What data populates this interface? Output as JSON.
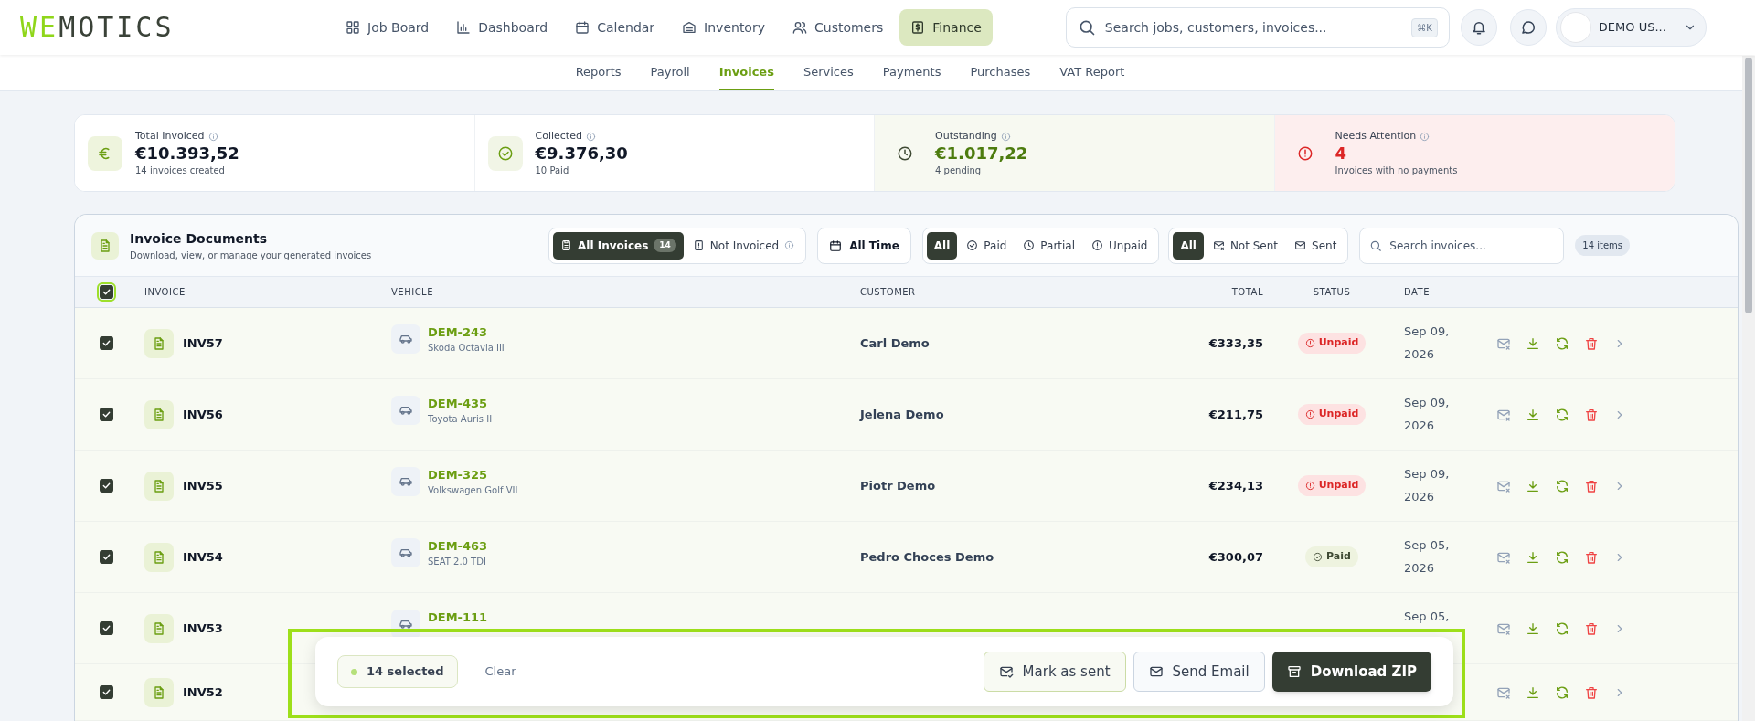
{
  "logo": {
    "part_1": "WE",
    "part_2": "MOTICS"
  },
  "nav": [
    {
      "label": "Job Board",
      "selected": false
    },
    {
      "label": "Dashboard",
      "selected": false
    },
    {
      "label": "Calendar",
      "selected": false
    },
    {
      "label": "Inventory",
      "selected": false
    },
    {
      "label": "Customers",
      "selected": false
    },
    {
      "label": "Finance",
      "selected": true
    }
  ],
  "search": {
    "placeholder": "Search jobs, customers, invoices...",
    "shortcut": "⌘K"
  },
  "user": {
    "name": "DEMO US..."
  },
  "subnav": [
    {
      "label": "Reports",
      "selected": false
    },
    {
      "label": "Payroll",
      "selected": false
    },
    {
      "label": "Invoices",
      "selected": true
    },
    {
      "label": "Services",
      "selected": false
    },
    {
      "label": "Payments",
      "selected": false
    },
    {
      "label": "Purchases",
      "selected": false
    },
    {
      "label": "VAT Report",
      "selected": false
    }
  ],
  "stats": [
    {
      "kind": "total",
      "label": "Total Invoiced",
      "value": "€10.393,52",
      "note": "14 invoices created"
    },
    {
      "kind": "collected",
      "label": "Collected",
      "value": "€9.376,30",
      "note": "10 Paid"
    },
    {
      "kind": "outstanding",
      "label": "Outstanding",
      "value": "€1.017,22",
      "note": "4 pending"
    },
    {
      "kind": "attention",
      "label": "Needs Attention",
      "value": "4",
      "note": "Invoices with no payments"
    }
  ],
  "panel": {
    "title": "Invoice Documents",
    "subtitle": "Download, view, or manage your generated invoices",
    "invoice_filters": [
      {
        "label": "All Invoices",
        "count": "14",
        "selected": true
      },
      {
        "label": "Not Invoiced",
        "selected": false
      }
    ],
    "period": "All Time",
    "payment_filters": [
      {
        "label": "All",
        "selected": true
      },
      {
        "label": "Paid",
        "selected": false
      },
      {
        "label": "Partial",
        "selected": false
      },
      {
        "label": "Unpaid",
        "selected": false
      }
    ],
    "sent_filters": [
      {
        "label": "All",
        "selected": true
      },
      {
        "label": "Not Sent",
        "selected": false
      },
      {
        "label": "Sent",
        "selected": false
      }
    ],
    "search_placeholder": "Search invoices...",
    "item_count": "14 items"
  },
  "table": {
    "all_selected": true,
    "columns": [
      "INVOICE",
      "VEHICLE",
      "CUSTOMER",
      "TOTAL",
      "STATUS",
      "DATE"
    ],
    "rows": [
      {
        "checked": true,
        "invoice": "INV57",
        "plate": "DEM-243",
        "model": "Skoda Octavia III",
        "customer": "Carl Demo",
        "total": "€333,35",
        "status": {
          "kind": "unpaid",
          "label": "Unpaid"
        },
        "date": "Sep 09, 2026"
      },
      {
        "checked": true,
        "invoice": "INV56",
        "plate": "DEM-435",
        "model": "Toyota Auris II",
        "customer": "Jelena Demo",
        "total": "€211,75",
        "status": {
          "kind": "unpaid",
          "label": "Unpaid"
        },
        "date": "Sep 09, 2026"
      },
      {
        "checked": true,
        "invoice": "INV55",
        "plate": "DEM-325",
        "model": "Volkswagen Golf VII",
        "customer": "Piotr Demo",
        "total": "€234,13",
        "status": {
          "kind": "unpaid",
          "label": "Unpaid"
        },
        "date": "Sep 09, 2026"
      },
      {
        "checked": true,
        "invoice": "INV54",
        "plate": "DEM-463",
        "model": "SEAT 2.0 TDI",
        "customer": "Pedro Choces Demo",
        "total": "€300,07",
        "status": {
          "kind": "paid",
          "label": "Paid"
        },
        "date": "Sep 05, 2026"
      },
      {
        "checked": true,
        "invoice": "INV53",
        "plate": "DEM-111",
        "date": "Sep 05,"
      },
      {
        "checked": true,
        "invoice": "INV52"
      }
    ]
  },
  "bulk_bar": {
    "selected": "14 selected",
    "clear": "Clear",
    "actions": [
      {
        "kind": "mark",
        "label": "Mark as sent"
      },
      {
        "kind": "email",
        "label": "Send Email"
      },
      {
        "kind": "zip",
        "label": "Download ZIP"
      }
    ]
  }
}
